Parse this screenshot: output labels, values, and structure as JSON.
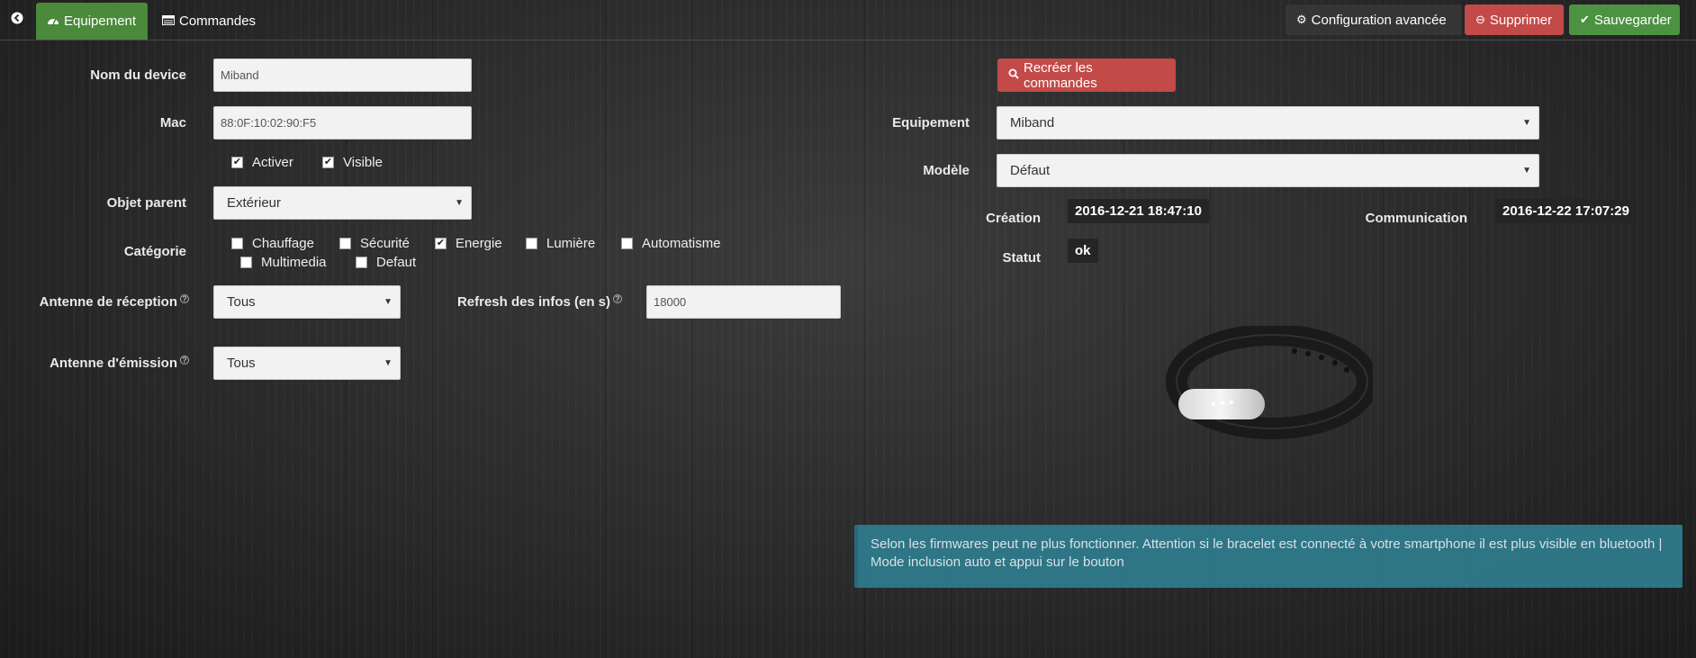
{
  "topbar": {
    "tabs": [
      {
        "label": "Equipement",
        "icon": "dashboard-icon"
      },
      {
        "label": "Commandes",
        "icon": "list-icon"
      }
    ],
    "buttons": {
      "config": "Configuration avancée",
      "delete": "Supprimer",
      "save": "Sauvegarder"
    }
  },
  "form": {
    "name_label": "Nom du device",
    "name_value": "Miband",
    "mac_label": "Mac",
    "mac_value": "88:0F:10:02:90:F5",
    "options": [
      {
        "label": "Activer",
        "checked": true
      },
      {
        "label": "Visible",
        "checked": true
      }
    ],
    "parent_label": "Objet parent",
    "parent_value": "Extérieur",
    "category_label": "Catégorie",
    "categories": [
      {
        "label": "Chauffage",
        "checked": false
      },
      {
        "label": "Sécurité",
        "checked": false
      },
      {
        "label": "Energie",
        "checked": true
      },
      {
        "label": "Lumière",
        "checked": false
      },
      {
        "label": "Automatisme",
        "checked": false
      },
      {
        "label": "Multimedia",
        "checked": false
      },
      {
        "label": "Defaut",
        "checked": false
      }
    ],
    "rx_label": "Antenne de réception",
    "rx_value": "Tous",
    "refresh_label": "Refresh des infos (en s)",
    "refresh_value": "18000",
    "tx_label": "Antenne d'émission",
    "tx_value": "Tous"
  },
  "right": {
    "recreate_label": "Recréer les commandes",
    "equip_label": "Equipement",
    "equip_value": "Miband",
    "model_label": "Modèle",
    "model_value": "Défaut",
    "creation_label": "Création",
    "creation_value": "2016-12-21 18:47:10",
    "communication_label": "Communication",
    "communication_value": "2016-12-22 17:07:29",
    "status_label": "Statut",
    "status_value": "ok",
    "alert_text": "Selon les firmwares peut ne plus fonctionner. Attention si le bracelet est connecté à votre smartphone il est plus visible en bluetooth | Mode inclusion auto et appui sur le bouton"
  },
  "colors": {
    "active_tab": "#4a8a3a",
    "danger": "#c24a48",
    "success": "#4d9243",
    "info": "#2f7c8e"
  }
}
